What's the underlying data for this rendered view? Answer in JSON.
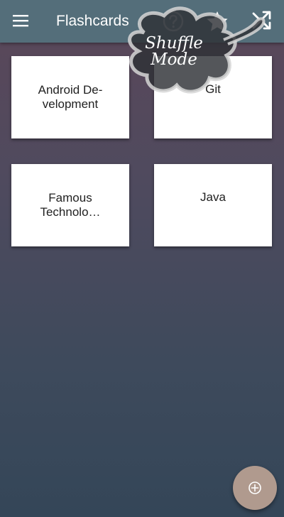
{
  "app_bar": {
    "title": "Flashcards",
    "icons": {
      "menu": "hamburger-menu-icon",
      "help": "help-circle-icon",
      "star": "star-icon",
      "shuffle": "shuffle-icon"
    },
    "color": "#546e7a"
  },
  "tooltip": {
    "line1": "Shuffle",
    "line2": "Mode"
  },
  "cards": [
    {
      "label": "Android De-\nvelopment"
    },
    {
      "label": "Git"
    },
    {
      "label": "Famous Technolo…"
    },
    {
      "label": "Java"
    }
  ],
  "fab": {
    "icon": "add-circle-icon",
    "color": "#b09a8e"
  }
}
